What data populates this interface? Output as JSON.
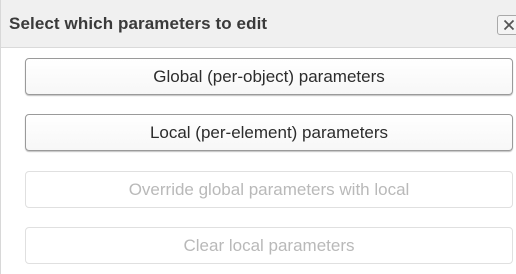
{
  "dialog": {
    "title": "Select which parameters to edit",
    "close_icon": "close-icon"
  },
  "buttons": [
    {
      "label": "Global (per-object) parameters",
      "enabled": true
    },
    {
      "label": "Local (per-element) parameters",
      "enabled": true
    },
    {
      "label": "Override global parameters with local",
      "enabled": false
    },
    {
      "label": "Clear local parameters",
      "enabled": false
    }
  ],
  "colors": {
    "titlebar_bg": "#f0f0f0",
    "enabled_text": "#2c2c2c",
    "disabled_text": "#b9b9b9"
  }
}
